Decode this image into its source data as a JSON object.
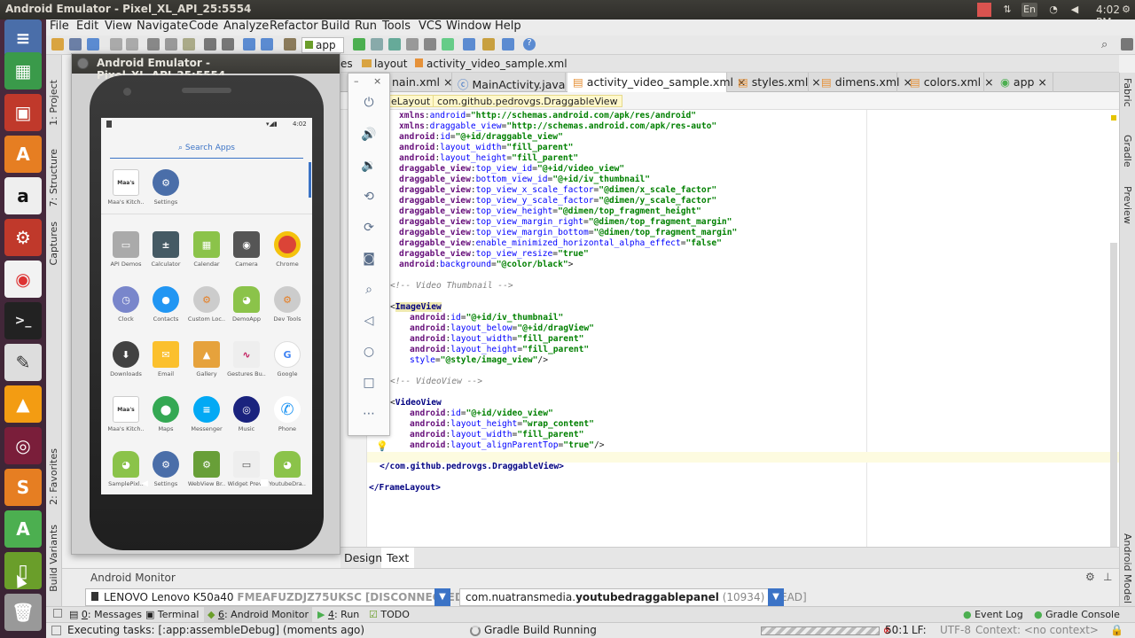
{
  "topbar": {
    "title": "Android Emulator - Pixel_XL_API_25:5554",
    "keyboard": "En",
    "time": "4:02 PM"
  },
  "menu": [
    "File",
    "Edit",
    "View",
    "Navigate",
    "Code",
    "Analyze",
    "Refactor",
    "Build",
    "Run",
    "Tools",
    "VCS",
    "Window",
    "Help"
  ],
  "toolbar": {
    "run_config": "app"
  },
  "nav": {
    "crumb1": "es",
    "crumb2": "layout",
    "crumb3": "activity_video_sample.xml"
  },
  "tabs": [
    "nain.xml",
    "MainActivity.java",
    "activity_video_sample.xml",
    "styles.xml",
    "dimens.xml",
    "colors.xml",
    "app"
  ],
  "breadcrumb": {
    "item1": "eLayout",
    "item2": "com.github.pedrovgs.DraggableView"
  },
  "code": {
    "l1": [
      "xmlns",
      "android",
      "\"http://schemas.android.com/apk/res/android\""
    ],
    "l2": [
      "xmlns",
      "draggable_view",
      "\"http://schemas.android.com/apk/res-auto\""
    ],
    "l3": [
      "android",
      "id",
      "\"@+id/draggable_view\""
    ],
    "l4": [
      "android",
      "layout_width",
      "\"fill_parent\""
    ],
    "l5": [
      "android",
      "layout_height",
      "\"fill_parent\""
    ],
    "l6": [
      "draggable_view",
      "top_view_id",
      "\"@+id/video_view\""
    ],
    "l7": [
      "draggable_view",
      "bottom_view_id",
      "\"@+id/iv_thumbnail\""
    ],
    "l8": [
      "draggable_view",
      "top_view_x_scale_factor",
      "\"@dimen/x_scale_factor\""
    ],
    "l9": [
      "draggable_view",
      "top_view_y_scale_factor",
      "\"@dimen/y_scale_factor\""
    ],
    "l10": [
      "draggable_view",
      "top_view_height",
      "\"@dimen/top_fragment_height\""
    ],
    "l11": [
      "draggable_view",
      "top_view_margin_right",
      "\"@dimen/top_fragment_margin\""
    ],
    "l12": [
      "draggable_view",
      "top_view_margin_bottom",
      "\"@dimen/top_fragment_margin\""
    ],
    "l13": [
      "draggable_view",
      "enable_minimized_horizontal_alpha_effect",
      "\"false\""
    ],
    "l14": [
      "draggable_view",
      "top_view_resize",
      "\"true\""
    ],
    "l15": [
      "android",
      "background",
      "\"@color/black\""
    ],
    "c1": "<!-- Video Thumbnail -->",
    "tag1": "ImageView",
    "i1": [
      "android",
      "id",
      "\"@+id/iv_thumbnail\""
    ],
    "i2": [
      "android",
      "layout_below",
      "\"@+id/dragView\""
    ],
    "i3": [
      "android",
      "layout_width",
      "\"fill_parent\""
    ],
    "i4": [
      "android",
      "layout_height",
      "\"fill_parent\""
    ],
    "i5": [
      "style",
      "\"@style/image_view\""
    ],
    "c2": "<!-- VideoView -->",
    "tag2": "VideoView",
    "v1": [
      "android",
      "id",
      "\"@+id/video_view\""
    ],
    "v2": [
      "android",
      "layout_height",
      "\"wrap_content\""
    ],
    "v3": [
      "android",
      "layout_width",
      "\"fill_parent\""
    ],
    "v4": [
      "android",
      "layout_alignParentTop",
      "\"true\""
    ],
    "close1": "</com.github.pedrovgs.DraggableView>",
    "close2": "</FrameLayout>"
  },
  "editor_tabs": {
    "design": "Design",
    "text": "Text"
  },
  "monitor": {
    "title": "Android Monitor",
    "device": "LENOVO Lenovo K50a40",
    "device_id": "FMEAFUZDJZ75UKSC",
    "device_state": "[DISCONNECTED]",
    "process_pkg": "com.nuatransmedia.",
    "process_name": "youtubedraggablepanel",
    "process_pid": "(10934)",
    "process_state": "[DEAD]"
  },
  "tooltabs": {
    "messages_num": "0",
    "messages": ": Messages",
    "terminal": "Terminal",
    "monitor_num": "6",
    "monitor": ": Android Monitor",
    "run_num": "4",
    "run": ": Run",
    "todo": "TODO",
    "eventlog": "Event Log",
    "gradle_console": "Gradle Console"
  },
  "status": {
    "task": "Executing tasks: [:app:assembleDebug] (moments ago)",
    "gradle": "Gradle Build Running",
    "pos": "50:1",
    "lf": "LF:",
    "enc": "UTF-8",
    "context": "Context: <no context>"
  },
  "left_panels": [
    "1: Project",
    "7: Structure",
    "Captures",
    "2: Favorites",
    "Build Variants"
  ],
  "right_panels": [
    "Fabric",
    "Gradle",
    "Preview",
    "Android Model"
  ],
  "emulator": {
    "title": "Android Emulator - Pixel_XL_API_25:5554",
    "clock": "4:02",
    "search": "Search Apps"
  },
  "apps_top": [
    "Maa's Kitch..",
    "Settings"
  ],
  "apps": [
    [
      "API Demos",
      "Calculator",
      "Calendar",
      "Camera",
      "Chrome"
    ],
    [
      "Clock",
      "Contacts",
      "Custom Loc..",
      "DemoApp",
      "Dev Tools"
    ],
    [
      "Downloads",
      "Email",
      "Gallery",
      "Gestures Bu..",
      "Google"
    ],
    [
      "Maa's Kitch..",
      "Maps",
      "Messenger",
      "Music",
      "Phone"
    ],
    [
      "SamplePixl..",
      "Settings",
      "WebView Br..",
      "Widget Prev..",
      "YoutubeDra.."
    ]
  ],
  "colors": {
    "accent": "#3b73c6",
    "launcher": "#4a2a3e"
  }
}
